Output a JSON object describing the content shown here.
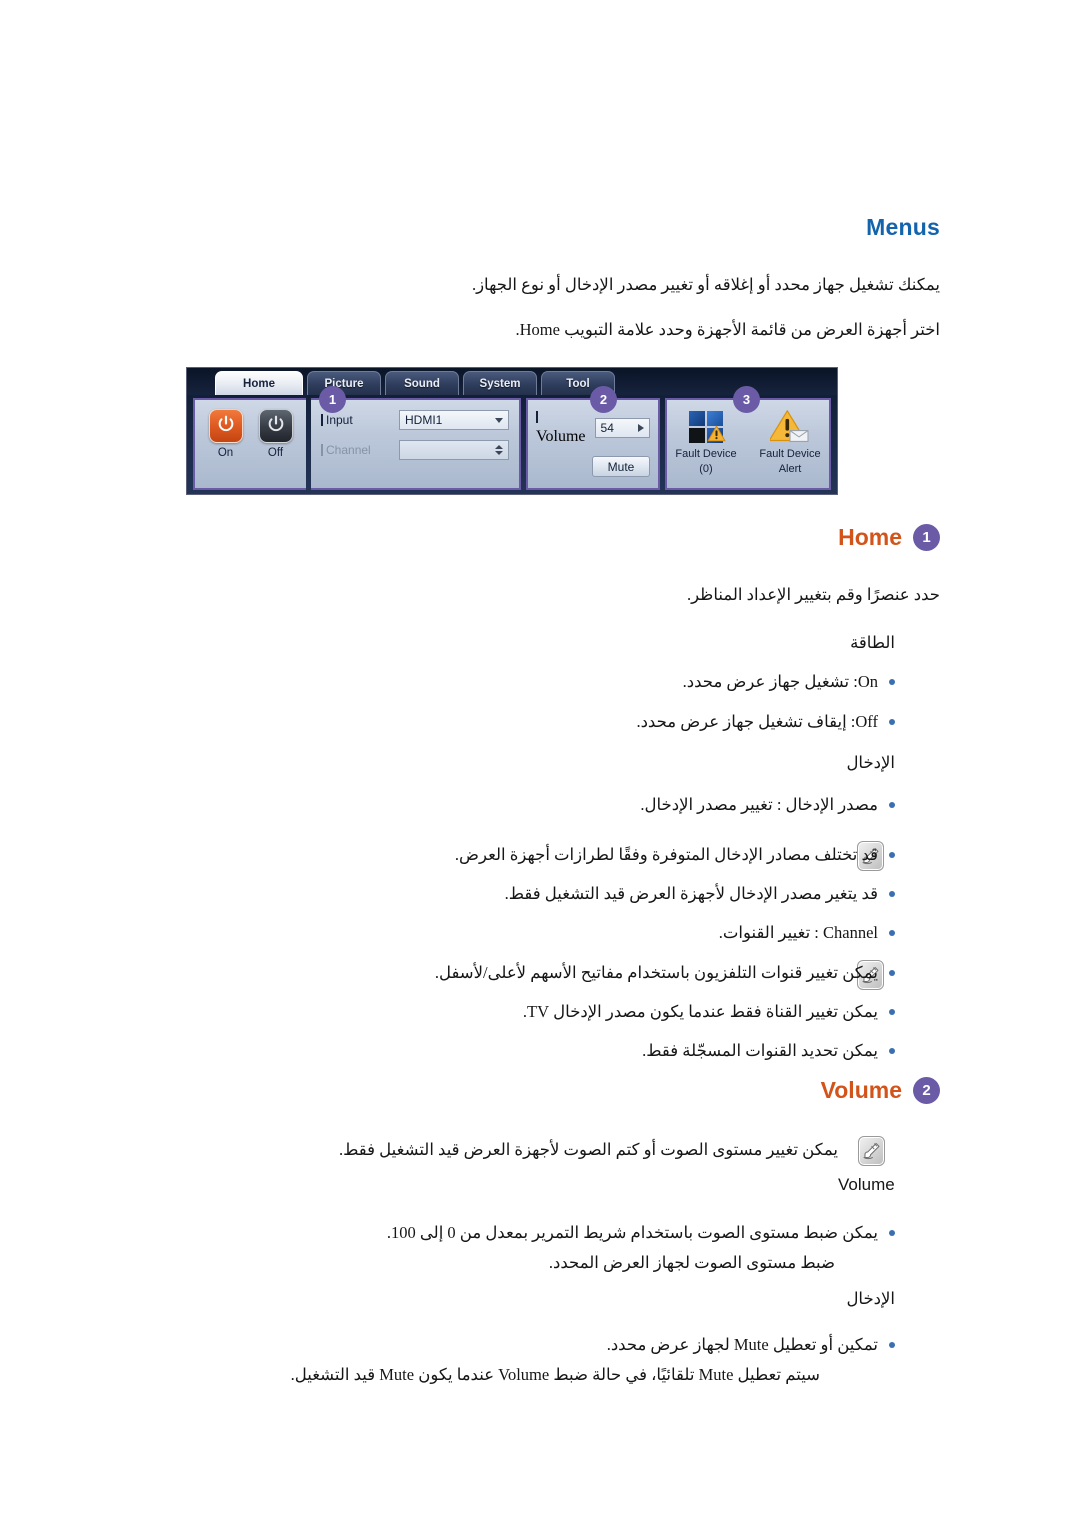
{
  "page": {
    "title_menus": "Menus",
    "intro": [
      "يمكنك تشغيل جهاز محدد أو إغلاقه أو تغيير مصدر الإدخال أو نوع الجهاز.",
      "اختر أجهزة العرض من قائمة الأجهزة وحدد علامة التبويب Home."
    ]
  },
  "colors": {
    "heading_blue": "#1464ad",
    "section_orange": "#d3541a",
    "badge_purple": "#6b5ba7",
    "bullet_blue": "#3a6fb0",
    "power_on_orange": "#df5a22"
  },
  "menu_screenshot": {
    "tabs": [
      {
        "label": "Home",
        "active": true
      },
      {
        "label": "Picture",
        "active": false
      },
      {
        "label": "Sound",
        "active": false
      },
      {
        "label": "System",
        "active": false
      },
      {
        "label": "Tool",
        "active": false
      }
    ],
    "panel_numbers": [
      "1",
      "2",
      "3"
    ],
    "power": {
      "on_label": "On",
      "off_label": "Off"
    },
    "input_panel": {
      "input_label": "Input",
      "input_value": "HDMI1",
      "channel_label": "Channel",
      "channel_value": ""
    },
    "volume_panel": {
      "volume_label": "Volume",
      "volume_value": "54",
      "mute_label": "Mute"
    },
    "fault_panel": {
      "fault_device_label": "Fault Device",
      "fault_device_count": "(0)",
      "fault_alert_label": "Fault Device",
      "fault_alert_label2": "Alert"
    }
  },
  "home_section": {
    "heading": "Home",
    "badge": "1",
    "intro": "حدد عنصرًا وقم بتغيير الإعداد المناظر.",
    "power_label": "الطاقة",
    "power_items": [
      "On: تشغيل جهاز عرض محدد.",
      "Off: إيقاف تشغيل جهاز عرض محدد."
    ],
    "input_label": "الإدخال",
    "input_items": [
      "مصدر الإدخال : تغيير مصدر الإدخال."
    ],
    "input_notes": [
      "قد تختلف مصادر الإدخال المتوفرة وفقًا لطرازات أجهزة العرض.",
      "قد يتغير مصدر الإدخال لأجهزة العرض قيد التشغيل فقط."
    ],
    "channel_items": [
      "Channel : تغيير القنوات."
    ],
    "channel_notes": [
      "يمكن تغيير قنوات التلفزيون باستخدام مفاتيح الأسهم لأعلى/لأسفل.",
      "يمكن تغيير القناة فقط عندما يكون مصدر الإدخال TV.",
      "يمكن تحديد القنوات المسجّلة فقط."
    ]
  },
  "volume_section": {
    "heading": "Volume",
    "badge": "2",
    "note": "يمكن تغيير مستوى الصوت أو كتم الصوت لأجهزة العرض قيد التشغيل فقط.",
    "caption": "Volume",
    "items": [
      "يمكن ضبط مستوى الصوت باستخدام شريط التمرير بمعدل من 0 إلى 100.",
      "ضبط مستوى الصوت لجهاز العرض المحدد."
    ],
    "input_label": "الإدخال",
    "mute_items": [
      "تمكين أو تعطيل Mute لجهاز عرض محدد.",
      "سيتم تعطيل Mute تلقائيًا، في حالة ضبط Volume عندما يكون Mute قيد التشغيل."
    ]
  },
  "icons": {
    "note_icon": "note-hand-icon",
    "power_icon": "power-icon",
    "warning_icon": "warning-triangle-icon",
    "caret_down": "chevron-down-icon",
    "caret_right": "chevron-right-icon",
    "spinner": "spinner-updown-icon"
  }
}
